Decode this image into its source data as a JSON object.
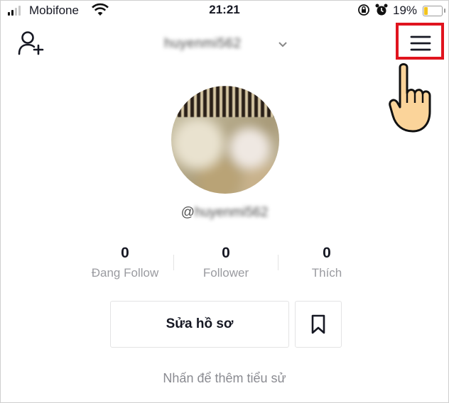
{
  "status_bar": {
    "carrier": "Mobifone",
    "time": "21:21",
    "battery_percent": "19%",
    "battery_level": 0.19,
    "icons": [
      "signal-icon",
      "wifi-icon",
      "orientation-lock-icon",
      "alarm-icon",
      "battery-icon"
    ]
  },
  "header": {
    "username": "huyenmi562",
    "icons": [
      "add-user-icon",
      "chevron-down-icon",
      "menu-icon",
      "hand-pointer-icon"
    ],
    "highlight_color": "#e0141e"
  },
  "profile": {
    "at_symbol": "@",
    "handle": "huyenmi562"
  },
  "stats": [
    {
      "value": "0",
      "label": "Đang Follow"
    },
    {
      "value": "0",
      "label": "Follower"
    },
    {
      "value": "0",
      "label": "Thích"
    }
  ],
  "actions": {
    "edit_profile_label": "Sửa hồ sơ",
    "bookmark_icon": "bookmark-icon"
  },
  "bio": {
    "prompt": "Nhấn để thêm tiểu sử"
  }
}
